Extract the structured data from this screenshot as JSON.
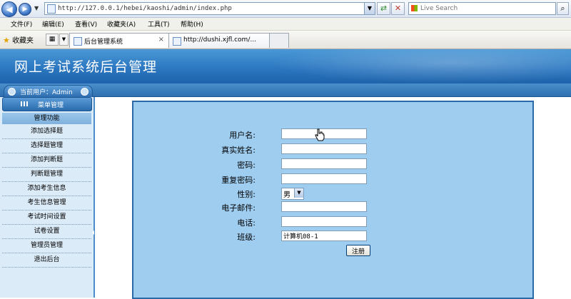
{
  "browser": {
    "address": "http://127.0.0.1/hebei/kaoshi/admin/index.php",
    "search_placeholder": "Live Search",
    "menu": [
      "文件(F)",
      "编辑(E)",
      "查看(V)",
      "收藏夹(A)",
      "工具(T)",
      "帮助(H)"
    ],
    "favorites_label": "收藏夹",
    "tabs": [
      {
        "label": "后台管理系统",
        "close": "×"
      },
      {
        "label": "http://dushi.xjfl.com/..."
      }
    ]
  },
  "header": {
    "title": "网上考试系统后台管理",
    "current_user": "当前用户：Admin"
  },
  "sidebar": {
    "menu_header": "菜单管理",
    "section": "管理功能",
    "items": [
      "添加选择题",
      "选择题管理",
      "添加判断题",
      "判断题管理",
      "添加考生信息",
      "考生信息管理",
      "考试时间设置",
      "试卷设置",
      "管理员管理",
      "退出后台"
    ]
  },
  "form": {
    "username_label": "用户名:",
    "username_value": "",
    "realname_label": "真实姓名:",
    "password_label": "密码:",
    "password2_label": "重复密码:",
    "gender_label": "性别:",
    "gender_value": "男",
    "email_label": "电子邮件:",
    "phone_label": "电话:",
    "class_label": "班级:",
    "class_value": "计算机08-1",
    "submit_label": "注册"
  }
}
